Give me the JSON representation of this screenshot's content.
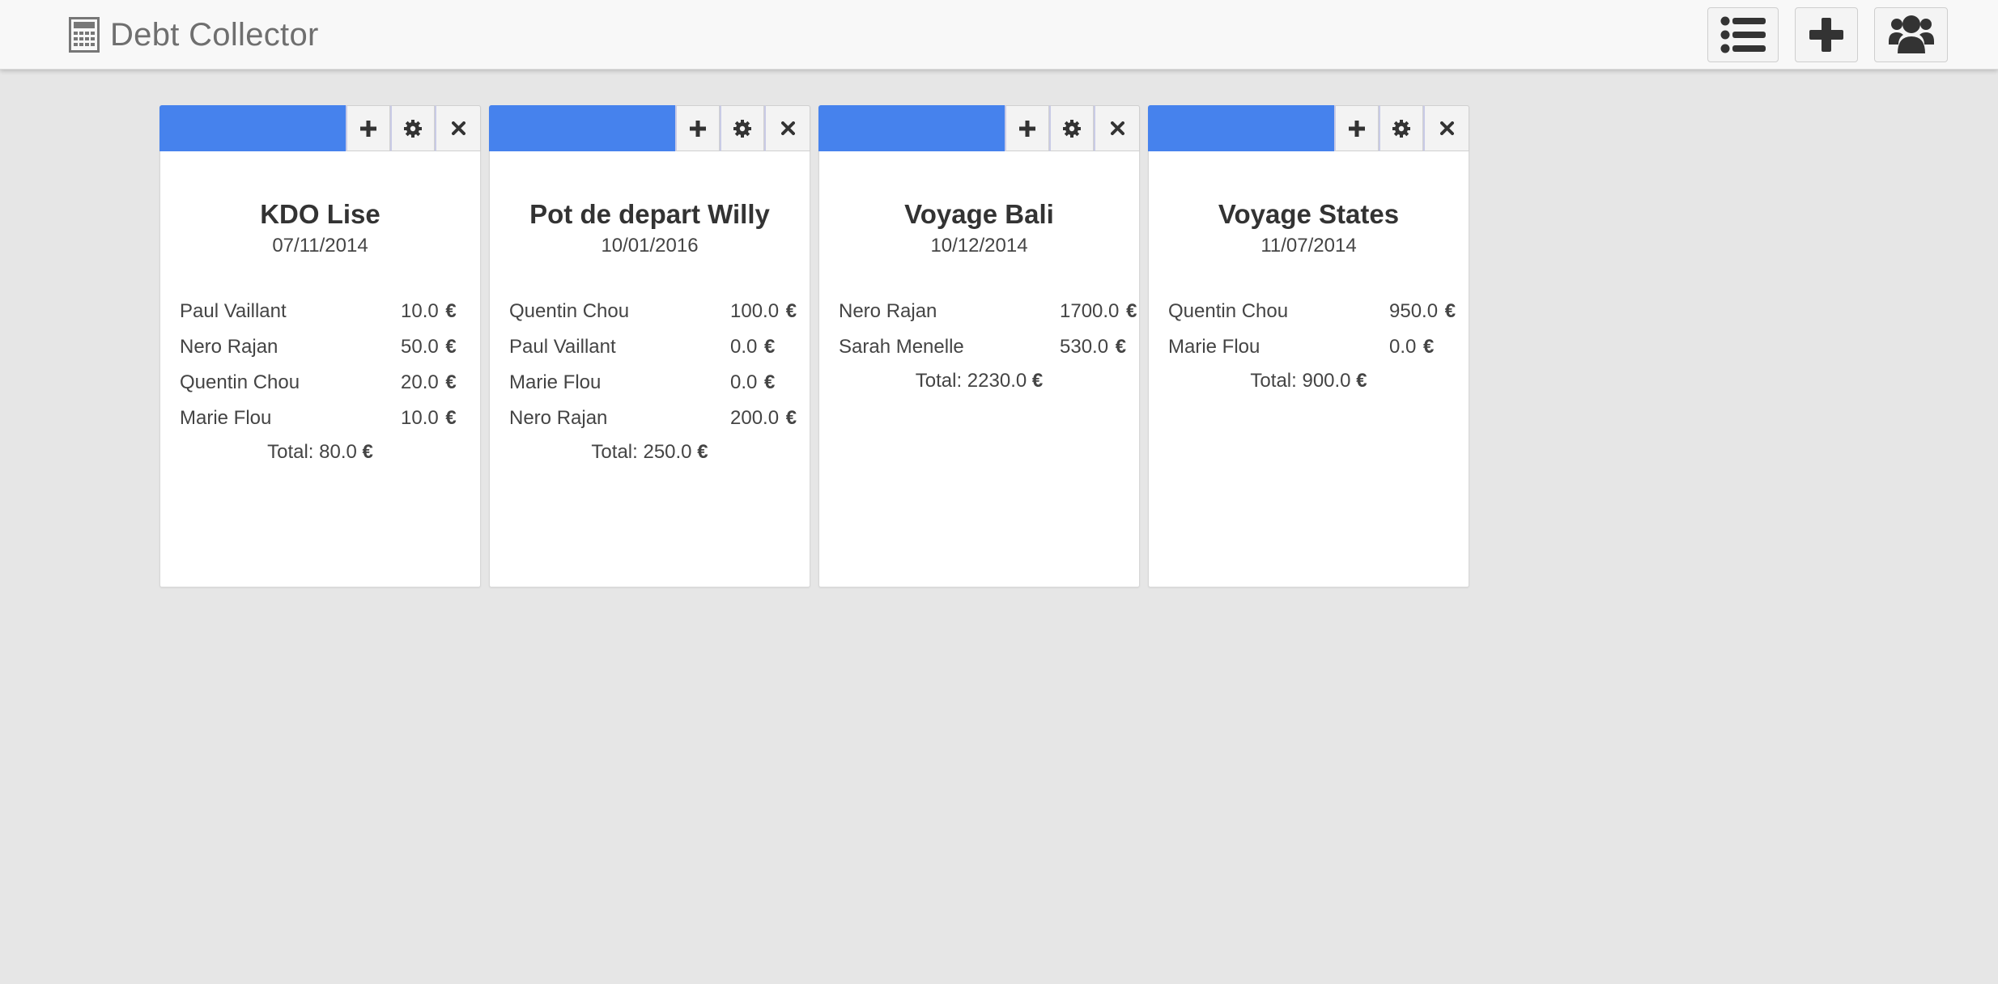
{
  "app": {
    "title": "Debt Collector"
  },
  "navbar": {
    "list_icon": "list-icon",
    "add_icon": "plus-icon",
    "users_icon": "users-icon"
  },
  "colors": {
    "card_accent": "#4682ed",
    "background": "#e6e6e6",
    "navbar": "#f8f8f8"
  },
  "cards": [
    {
      "title": "KDO Lise",
      "date": "07/11/2014",
      "debts": [
        {
          "name": "Paul Vaillant",
          "amount": "10.0",
          "currency": "€"
        },
        {
          "name": "Nero Rajan",
          "amount": "50.0",
          "currency": "€"
        },
        {
          "name": "Quentin Chou",
          "amount": "20.0",
          "currency": "€"
        },
        {
          "name": "Marie Flou",
          "amount": "10.0",
          "currency": "€"
        }
      ],
      "total_label": "Total:",
      "total": "80.0",
      "total_currency": "€"
    },
    {
      "title": "Pot de depart Willy",
      "date": "10/01/2016",
      "debts": [
        {
          "name": "Quentin Chou",
          "amount": "100.0",
          "currency": "€"
        },
        {
          "name": "Paul Vaillant",
          "amount": "0.0",
          "currency": "€"
        },
        {
          "name": "Marie Flou",
          "amount": "0.0",
          "currency": "€"
        },
        {
          "name": "Nero Rajan",
          "amount": "200.0",
          "currency": "€"
        }
      ],
      "total_label": "Total:",
      "total": "250.0",
      "total_currency": "€"
    },
    {
      "title": "Voyage Bali",
      "date": "10/12/2014",
      "debts": [
        {
          "name": "Nero Rajan",
          "amount": "1700.0",
          "currency": "€"
        },
        {
          "name": "Sarah Menelle",
          "amount": "530.0",
          "currency": "€"
        }
      ],
      "total_label": "Total:",
      "total": "2230.0",
      "total_currency": "€"
    },
    {
      "title": "Voyage States",
      "date": "11/07/2014",
      "debts": [
        {
          "name": "Quentin Chou",
          "amount": "950.0",
          "currency": "€"
        },
        {
          "name": "Marie Flou",
          "amount": "0.0",
          "currency": "€"
        }
      ],
      "total_label": "Total:",
      "total": "900.0",
      "total_currency": "€"
    }
  ]
}
